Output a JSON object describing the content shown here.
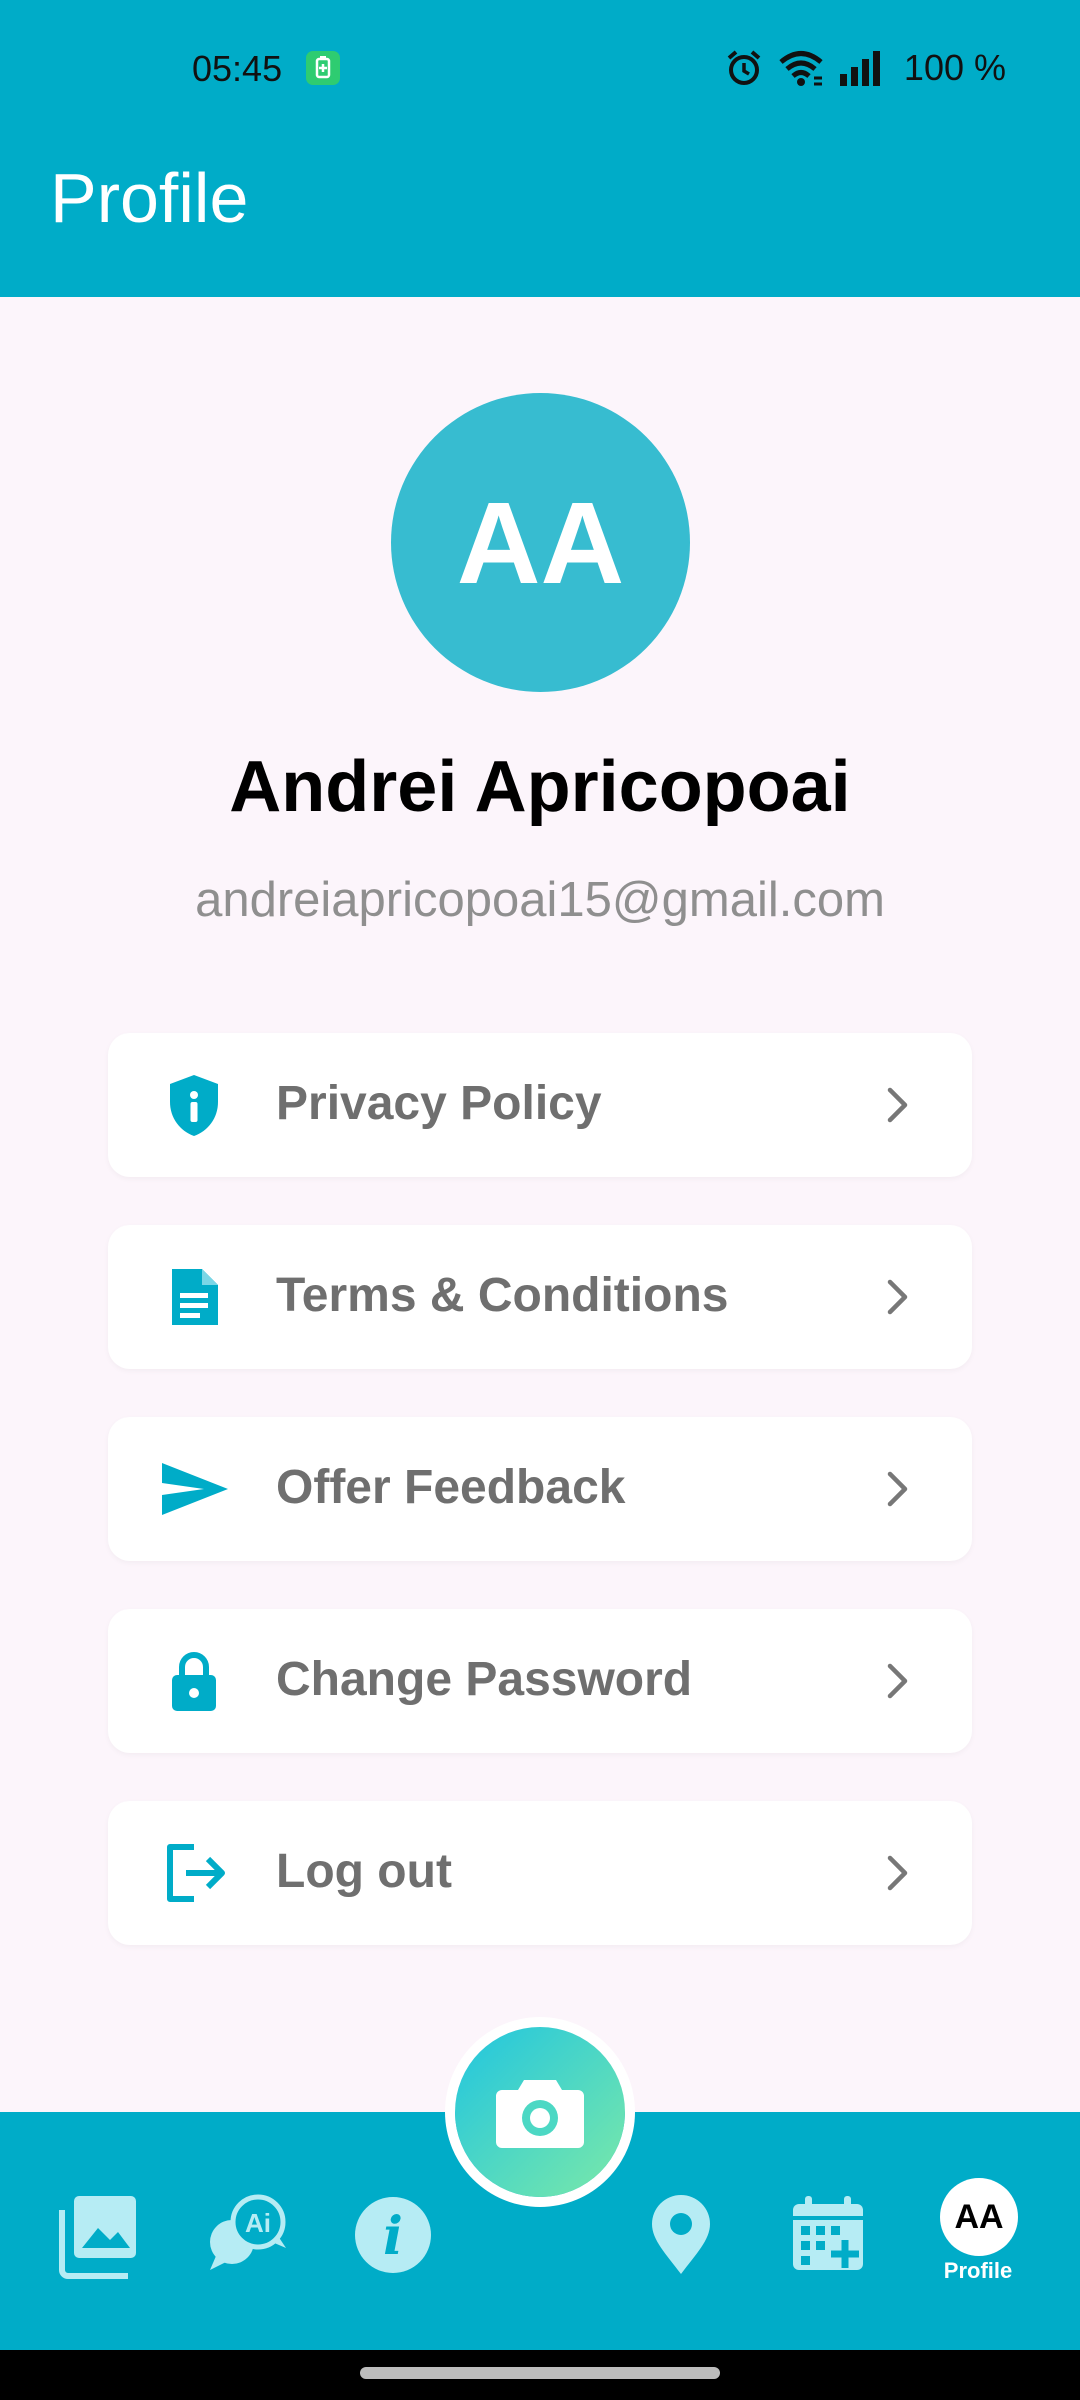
{
  "status_bar": {
    "time": "05:45",
    "battery": "100 %",
    "icons": [
      "battery-saver-icon",
      "alarm-icon",
      "wifi-icon",
      "signal-icon"
    ]
  },
  "header": {
    "title": "Profile"
  },
  "profile": {
    "initials": "AA",
    "name": "Andrei Apricopoai",
    "email": "andreiapricopoai15@gmail.com"
  },
  "menu": [
    {
      "label": "Privacy Policy",
      "icon": "shield-info-icon"
    },
    {
      "label": "Terms & Conditions",
      "icon": "document-icon"
    },
    {
      "label": "Offer Feedback",
      "icon": "send-icon"
    },
    {
      "label": "Change Password",
      "icon": "lock-icon"
    },
    {
      "label": "Log out",
      "icon": "logout-icon"
    }
  ],
  "bottom_nav": {
    "items": [
      "gallery-icon",
      "ai-chat-icon",
      "info-icon",
      "camera-icon",
      "location-icon",
      "calendar-add-icon"
    ],
    "profile_initials": "AA",
    "profile_label": "Profile"
  },
  "colors": {
    "primary": "#00acc8",
    "avatar": "#37bcd0",
    "background": "#fcf5fb",
    "menu_text": "#6f6f6f"
  }
}
